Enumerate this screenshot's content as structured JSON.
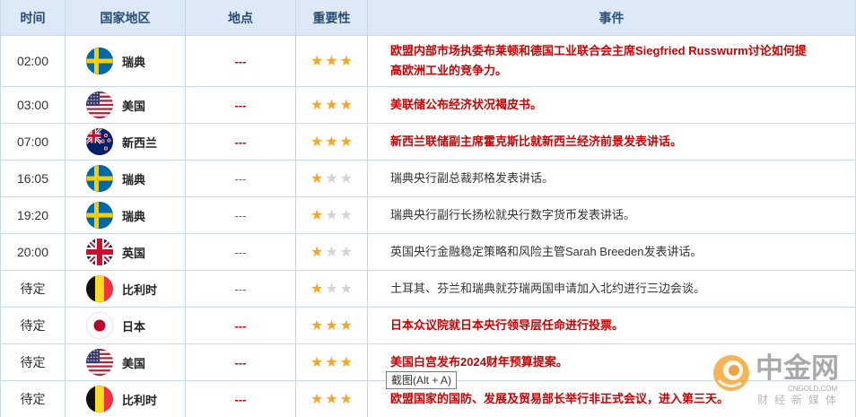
{
  "colors": {
    "header_bg": "#dde9f6",
    "header_text": "#294c74",
    "border": "#c5d8ec",
    "highlight": "#cc0000",
    "text": "#333333",
    "star_filled": "#f5a623",
    "star_empty": "#d4d4d4"
  },
  "table": {
    "headers": {
      "time": "时间",
      "country": "国家地区",
      "location": "地点",
      "importance": "重要性",
      "event": "事件"
    },
    "rows": [
      {
        "time": "02:00",
        "flag": "sweden-flag-icon",
        "country": "瑞典",
        "location": "---",
        "importance": 3,
        "event": "欧盟内部市场执委布莱顿和德国工业联合会主席Siegfried Russwurm讨论如何提高欧洲工业的竞争力。"
      },
      {
        "time": "03:00",
        "flag": "usa-flag-icon",
        "country": "美国",
        "location": "---",
        "importance": 3,
        "event": "美联储公布经济状况褐皮书。"
      },
      {
        "time": "07:00",
        "flag": "new-zealand-flag-icon",
        "country": "新西兰",
        "location": "---",
        "importance": 3,
        "event": "新西兰联储副主席霍克斯比就新西兰经济前景发表讲话。"
      },
      {
        "time": "16:05",
        "flag": "sweden-flag-icon",
        "country": "瑞典",
        "location": "---",
        "importance": 1,
        "event": "瑞典央行副总裁邦格发表讲话。"
      },
      {
        "time": "19:20",
        "flag": "sweden-flag-icon",
        "country": "瑞典",
        "location": "---",
        "importance": 1,
        "event": "瑞典央行副行长扬松就央行数字货币发表讲话。"
      },
      {
        "time": "20:00",
        "flag": "uk-flag-icon",
        "country": "英国",
        "location": "---",
        "importance": 1,
        "event": "英国央行金融稳定策略和风险主管Sarah Breeden发表讲话。"
      },
      {
        "time": "待定",
        "flag": "belgium-flag-icon",
        "country": "比利时",
        "location": "---",
        "importance": 1,
        "event": "土耳其、芬兰和瑞典就芬瑞两国申请加入北约进行三边会谈。"
      },
      {
        "time": "待定",
        "flag": "japan-flag-icon",
        "country": "日本",
        "location": "---",
        "importance": 3,
        "event": "日本众议院就日本央行领导层任命进行投票。"
      },
      {
        "time": "待定",
        "flag": "usa-flag-icon",
        "country": "美国",
        "location": "---",
        "importance": 3,
        "event": "美国白宫发布2024财年预算提案。"
      },
      {
        "time": "待定",
        "flag": "belgium-flag-icon",
        "country": "比利时",
        "location": "---",
        "importance": 3,
        "event": "欧盟国家的国防、发展及贸易部长举行非正式会议，进入第三天。"
      }
    ]
  },
  "tooltip": {
    "text": "截图(Alt + A)"
  },
  "watermark": {
    "brand": "中金网",
    "domain": "CNGOLD.COM",
    "slogan": "财经新媒体"
  }
}
